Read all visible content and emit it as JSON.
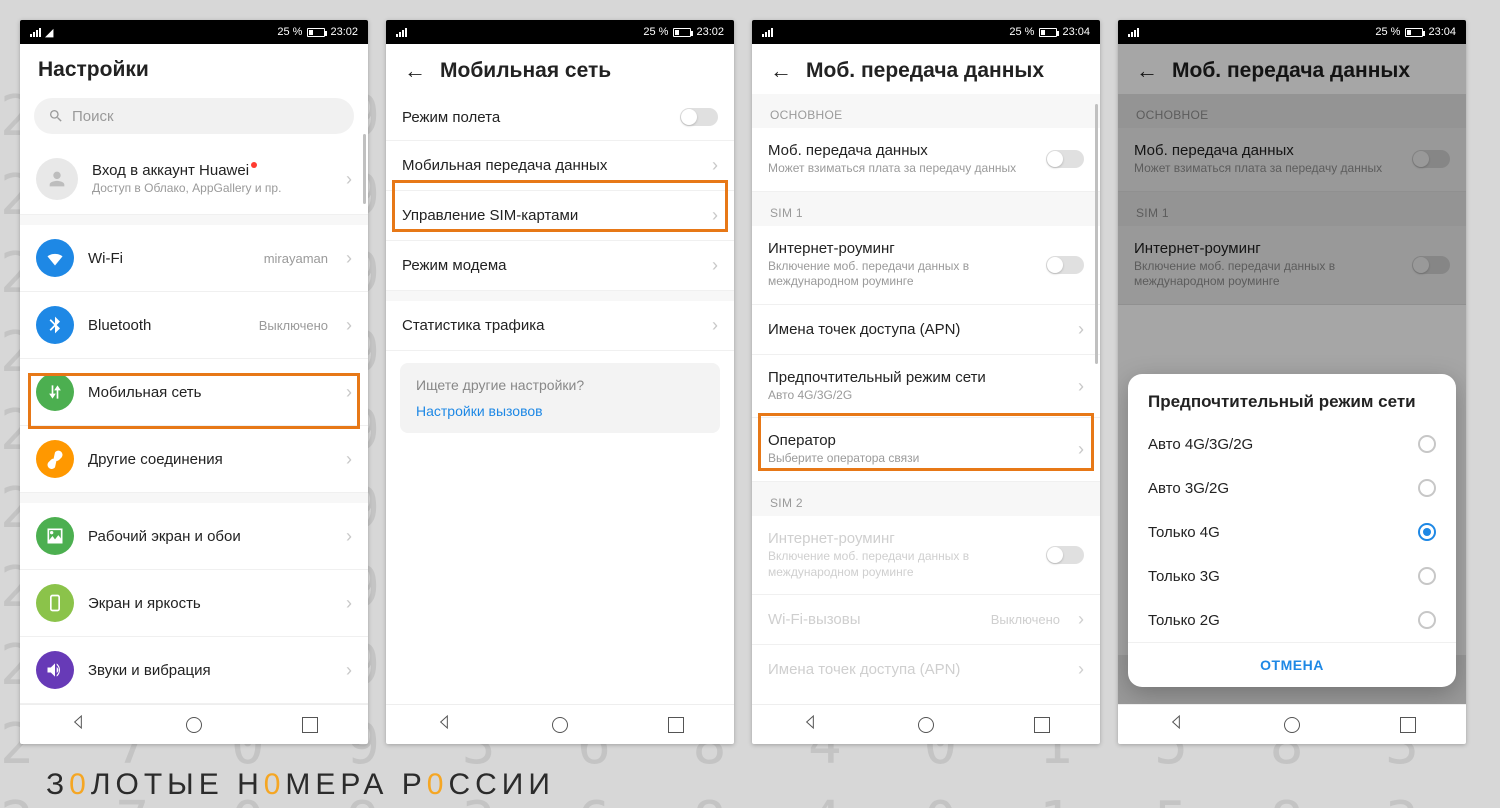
{
  "status": {
    "battery": "25 %",
    "time1": "23:02",
    "time2": "23:04"
  },
  "s1": {
    "title": "Настройки",
    "search": "Поиск",
    "account_title": "Вход в аккаунт Huawei",
    "account_sub": "Доступ в Облако, AppGallery и пр.",
    "wifi": "Wi-Fi",
    "wifi_val": "mirayaman",
    "bt": "Bluetooth",
    "bt_val": "Выключено",
    "mobile": "Мобильная сеть",
    "other": "Другие соединения",
    "home": "Рабочий экран и обои",
    "display": "Экран и яркость",
    "sound": "Звуки и вибрация"
  },
  "s2": {
    "title": "Мобильная сеть",
    "airplane": "Режим полета",
    "mobiledata": "Мобильная передача данных",
    "sim": "Управление SIM-картами",
    "tether": "Режим модема",
    "traffic": "Статистика трафика",
    "tip_q": "Ищете другие настройки?",
    "tip_link": "Настройки вызовов"
  },
  "s3": {
    "title": "Моб. передача данных",
    "sec_main": "ОСНОВНОЕ",
    "md": "Моб. передача данных",
    "md_sub": "Может взиматься плата за передачу данных",
    "sec_sim1": "SIM 1",
    "roam": "Интернет-роуминг",
    "roam_sub": "Включение моб. передачи данных в международном роуминге",
    "apn": "Имена точек доступа (APN)",
    "pref": "Предпочтительный режим сети",
    "pref_sub": "Авто 4G/3G/2G",
    "oper": "Оператор",
    "oper_sub": "Выберите оператора связи",
    "sec_sim2": "SIM 2",
    "wificall": "Wi-Fi-вызовы",
    "wificall_val": "Выключено"
  },
  "dialog": {
    "title": "Предпочтительный режим сети",
    "o1": "Авто 4G/3G/2G",
    "o2": "Авто 3G/2G",
    "o3": "Только 4G",
    "o4": "Только 3G",
    "o5": "Только 2G",
    "cancel": "ОТМЕНА"
  },
  "logo": {
    "p1": "З",
    "p2": "ЛОТЫЕ Н",
    "p3": "МЕРА Р",
    "p4": "ССИИ"
  }
}
